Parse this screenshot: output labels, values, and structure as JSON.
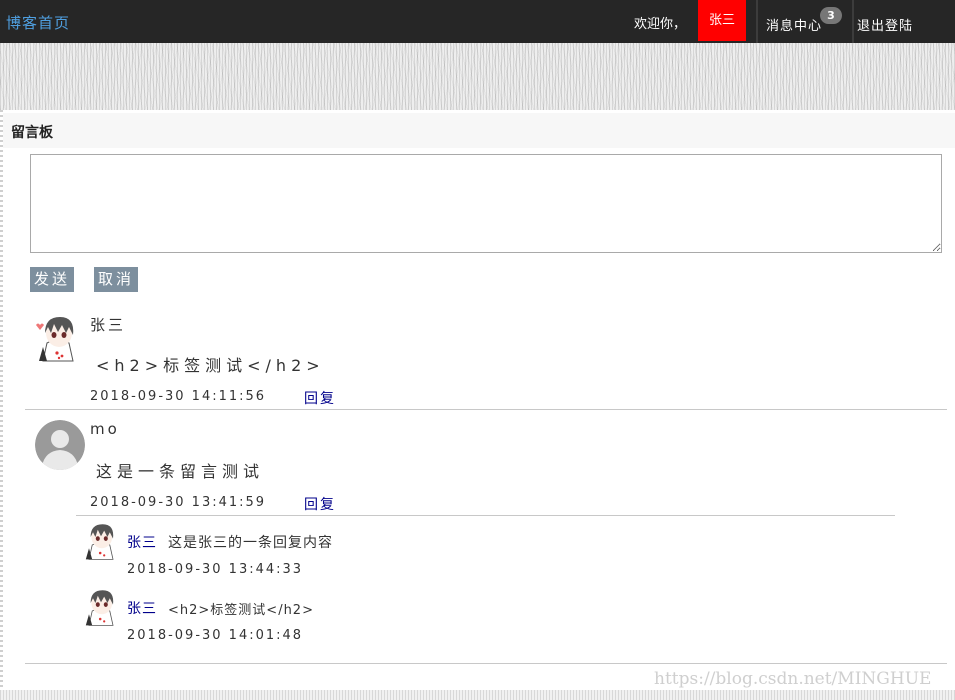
{
  "nav": {
    "home_label": "博客首页",
    "welcome_label": "欢迎你，",
    "user_label": "张三",
    "messages_label": "消息中心",
    "messages_badge": "3",
    "logout_label": "退出登陆",
    "user_bg_color": "#ff0000",
    "bar_color": "#262626",
    "home_color": "#4f9fe0"
  },
  "board": {
    "title": "留言板",
    "input_value": "",
    "send_label": "发送",
    "cancel_label": "取消",
    "button_color": "#7d8f9e"
  },
  "messages": [
    {
      "author": "张三",
      "avatar": "anime-avatar-icon",
      "content": "<h2>标签测试</h2>",
      "time": "2018-09-30 14:11:56",
      "reply_label": "回复",
      "replies": []
    },
    {
      "author": "mo",
      "avatar": "default-user-avatar-icon",
      "content": "这是一条留言测试",
      "time": "2018-09-30 13:41:59",
      "reply_label": "回复",
      "replies": [
        {
          "author": "张三",
          "avatar": "anime-avatar-icon",
          "content": "这是张三的一条回复内容",
          "time": "2018-09-30 13:44:33"
        },
        {
          "author": "张三",
          "avatar": "anime-avatar-icon",
          "content": "<h2>标签测试</h2>",
          "time": "2018-09-30 14:01:48"
        }
      ]
    }
  ],
  "watermark": "https://blog.csdn.net/MINGHUE",
  "link_color": "#00008b"
}
